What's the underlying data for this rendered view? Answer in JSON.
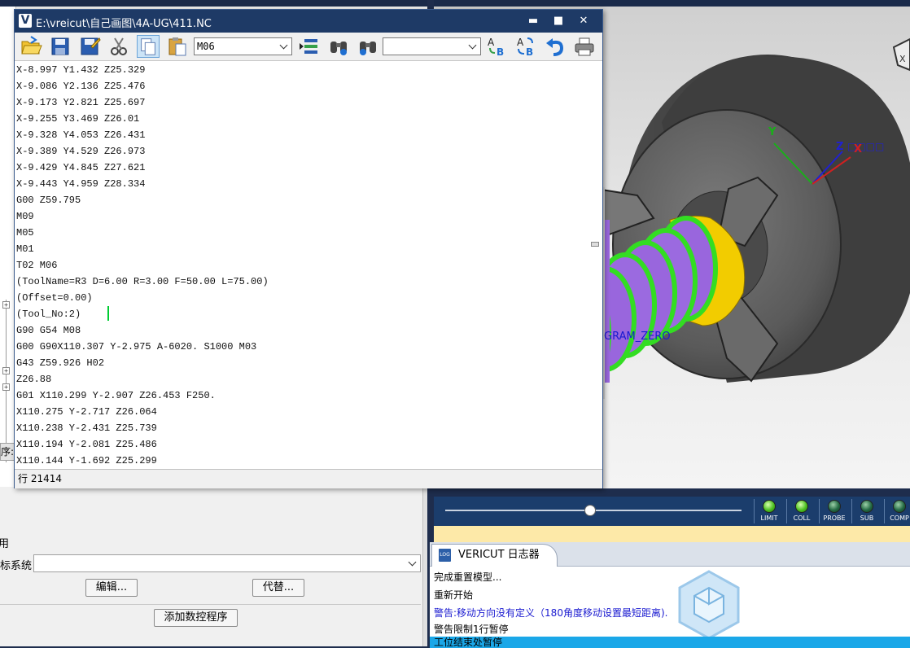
{
  "nc_window": {
    "title": "E:\\vreicut\\自己画图\\4A-UG\\411.NC",
    "title_icon": "V",
    "minimize": "▬",
    "maximize": "■",
    "close": "✕",
    "toolbar": {
      "icons": [
        "open-folder-icon",
        "save-icon",
        "save-as-icon",
        "cut-icon",
        "copy-icon",
        "paste-icon",
        "goto-line-icon",
        "find-icon",
        "find-next-icon",
        "replace-icon",
        "replace-all-icon",
        "undo-icon",
        "print-icon"
      ],
      "search_combo_value": "M06",
      "replace_combo_value": ""
    },
    "lines": [
      "X-8.997 Y1.432 Z25.329",
      "X-9.086 Y2.136 Z25.476",
      "X-9.173 Y2.821 Z25.697",
      "X-9.255 Y3.469 Z26.01",
      "X-9.328 Y4.053 Z26.431",
      "X-9.389 Y4.529 Z26.973",
      "X-9.429 Y4.845 Z27.621",
      "X-9.443 Y4.959 Z28.334",
      "G00 Z59.795",
      "M09",
      "M05",
      "M01",
      "T02 M06",
      "(ToolName=R3 D=6.00 R=3.00 F=50.00 L=75.00)",
      "(Offset=0.00)",
      "(Tool_No:2)",
      "G90 G54 M08",
      "G00 G90X110.307 Y-2.975 A-6020. S1000 M03",
      "G43 Z59.926 H02",
      "Z26.88",
      "G01 X110.299 Y-2.907 Z26.453 F250.",
      "X110.275 Y-2.717 Z26.064",
      "X110.238 Y-2.431 Z25.739",
      "X110.194 Y-2.081 Z25.486",
      "X110.144 Y-1.692 Z25.299"
    ],
    "status": "行 21414"
  },
  "left_panel": {
    "tab_label": "程序:",
    "label_use": "用",
    "label_coord": "标系统",
    "coord_select_value": "",
    "edit_button": "编辑...",
    "replace_button": "代替...",
    "add_nc_button": "添加数控程序"
  },
  "viewport": {
    "axis_y": "Y",
    "axis_z": "Z",
    "axis_z_suffix": "□□□□",
    "axis_x": "X",
    "program_zero_label": "GRAM_ZERO",
    "corner_label": "X"
  },
  "sim_controls": {
    "slider_value": 0.49,
    "leds": [
      {
        "label": "LIMIT",
        "state": "on"
      },
      {
        "label": "COLL",
        "state": "on"
      },
      {
        "label": "PROBE",
        "state": "off"
      },
      {
        "label": "SUB",
        "state": "off"
      },
      {
        "label": "COMP",
        "state": "off"
      }
    ]
  },
  "logger": {
    "tab_label": "VERICUT 日志器",
    "tab_icon_text": "LOG",
    "lines": [
      {
        "text": "完成重置模型...",
        "color": "#000000"
      },
      {
        "text": "重新开始",
        "color": "#000000"
      },
      {
        "text": "警告:移动方向没有定义（180角度移动设置最短距离).",
        "color": "#1a1ad0"
      },
      {
        "text": "警告限制1行暂停",
        "color": "#000000"
      },
      {
        "text": "工位结束处暂停",
        "color": "#000000"
      }
    ]
  },
  "colors": {
    "title_bar": "#1e3a66",
    "highlight": "#1aa7e8",
    "part_purple": "#9966dd",
    "part_green": "#33dd22",
    "part_yellow": "#f2cc00"
  }
}
